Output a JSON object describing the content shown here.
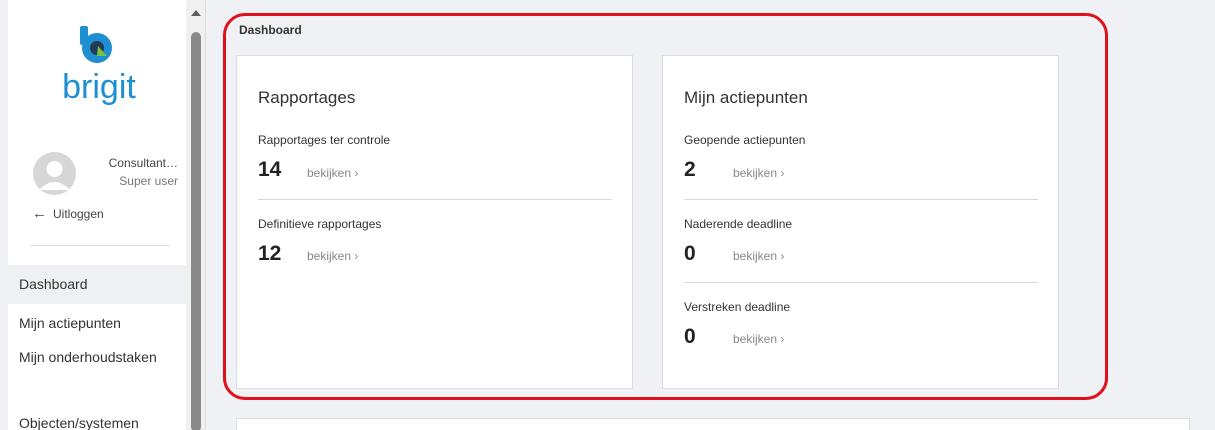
{
  "app": {
    "logo_text": "brigit"
  },
  "user": {
    "name": "Consultant…",
    "role": "Super user",
    "logout_label": "Uitloggen"
  },
  "nav": {
    "items": [
      {
        "label": "Dashboard",
        "active": true
      },
      {
        "label": "Mijn actiepunten"
      },
      {
        "label": "Mijn onderhoudstaken"
      },
      {
        "label": "Objecten/systemen"
      }
    ]
  },
  "page": {
    "breadcrumb": "Dashboard"
  },
  "cards": {
    "rapportages": {
      "title": "Rapportages",
      "metrics": [
        {
          "label": "Rapportages ter controle",
          "value": "14",
          "link": "bekijken ›"
        },
        {
          "label": "Definitieve rapportages",
          "value": "12",
          "link": "bekijken ›"
        }
      ]
    },
    "actiepunten": {
      "title": "Mijn actiepunten",
      "metrics": [
        {
          "label": "Geopende actiepunten",
          "value": "2",
          "link": "bekijken ›"
        },
        {
          "label": "Naderende deadline",
          "value": "0",
          "link": "bekijken ›"
        },
        {
          "label": "Verstreken deadline",
          "value": "0",
          "link": "bekijken ›"
        }
      ]
    }
  },
  "colors": {
    "brand_blue": "#1e8fd0",
    "brand_dark": "#233b57",
    "brand_green": "#7ac143",
    "highlight": "#e0101c"
  },
  "icons": {
    "logout": "arrow-left-icon",
    "avatar": "user-avatar-icon",
    "scroll_up": "triangle-up-icon"
  }
}
